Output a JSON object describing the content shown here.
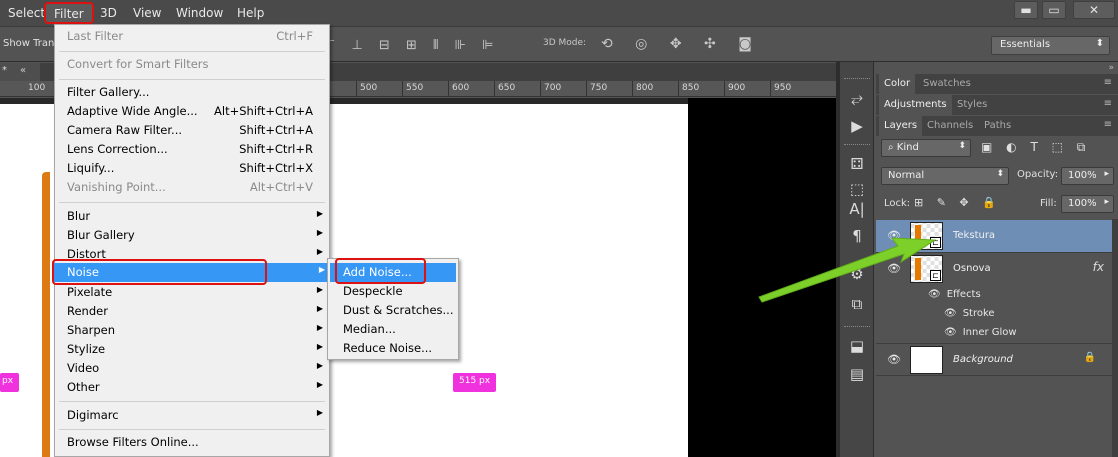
{
  "menubar": {
    "items": [
      "Select",
      "Filter",
      "3D",
      "View",
      "Window",
      "Help"
    ],
    "active": "Filter",
    "window_buttons": [
      "▬",
      "▭",
      "✕"
    ]
  },
  "options": {
    "show_label": "Show Tran",
    "mode3d_label": "3D Mode:",
    "align_icons": "⊤ ⊥ ⊟ ⊞ ⫴ ⊪ ⊫",
    "mode3d_icons": "⟲ ◎ ✥ ✣ ◙",
    "workspace": "Essentials",
    "workspace_arrow": "⬍"
  },
  "document": {
    "tab_marker": "*",
    "tab_scroll": "«",
    "ruler_numbers": [
      "100",
      "500",
      "550",
      "600",
      "650",
      "700",
      "750",
      "800",
      "850",
      "900",
      "950"
    ]
  },
  "canvas": {
    "left_badge": "px",
    "right_badge": "515 px"
  },
  "filter_menu": {
    "last_filter": {
      "label": "Last Filter",
      "shortcut": "Ctrl+F"
    },
    "convert": "Convert for Smart Filters",
    "filter_gallery": "Filter Gallery...",
    "adaptive": {
      "label": "Adaptive Wide Angle...",
      "shortcut": "Alt+Shift+Ctrl+A"
    },
    "camera_raw": {
      "label": "Camera Raw Filter...",
      "shortcut": "Shift+Ctrl+A"
    },
    "lens": {
      "label": "Lens Correction...",
      "shortcut": "Shift+Ctrl+R"
    },
    "liquify": {
      "label": "Liquify...",
      "shortcut": "Shift+Ctrl+X"
    },
    "vanishing": {
      "label": "Vanishing Point...",
      "shortcut": "Alt+Ctrl+V"
    },
    "submenus": [
      "Blur",
      "Blur Gallery",
      "Distort",
      "Noise",
      "Pixelate",
      "Render",
      "Sharpen",
      "Stylize",
      "Video",
      "Other"
    ],
    "digimarc": "Digimarc",
    "browse": "Browse Filters Online...",
    "submenu_arrow": "▶"
  },
  "noise_submenu": {
    "items": [
      "Add Noise...",
      "Despeckle",
      "Dust & Scratches...",
      "Median...",
      "Reduce Noise..."
    ]
  },
  "tools": {
    "icons": [
      "⥂",
      "▶",
      "⚃",
      "⬚",
      "A|",
      "¶",
      "⚙",
      "⧉",
      "⬓",
      "▤",
      "✎"
    ]
  },
  "panels": {
    "group1_tabs": [
      "Color",
      "Swatches"
    ],
    "group2_tabs": [
      "Adjustments",
      "Styles"
    ],
    "group3_tabs": [
      "Layers",
      "Channels",
      "Paths"
    ],
    "panel_menu": "≡",
    "collapse": "»",
    "kind": "Kind",
    "kind_icon": "⌕",
    "filter_icons": "▣ ◐ T ⬚ ⧉",
    "blend_mode": "Normal",
    "opacity_label": "Opacity:",
    "opacity": "100%",
    "lock_label": "Lock:",
    "lock_icons": "⊞ ✎ ✥ 🔒",
    "fill_label": "Fill:",
    "fill": "100%",
    "eye": "👁",
    "layers": [
      {
        "name": "Tekstura"
      },
      {
        "name": "Osnova",
        "fx": "fx"
      },
      {
        "name": "Background",
        "lock": "🔒"
      }
    ],
    "effects_label": "Effects",
    "effects": [
      "Stroke",
      "Inner Glow"
    ]
  },
  "colors": {
    "accent_blue": "#3697f5",
    "highlight_red": "#dd1111",
    "arrow_green": "#7dcf2a",
    "orange": "#e57900",
    "badge_pink": "#f031de"
  }
}
